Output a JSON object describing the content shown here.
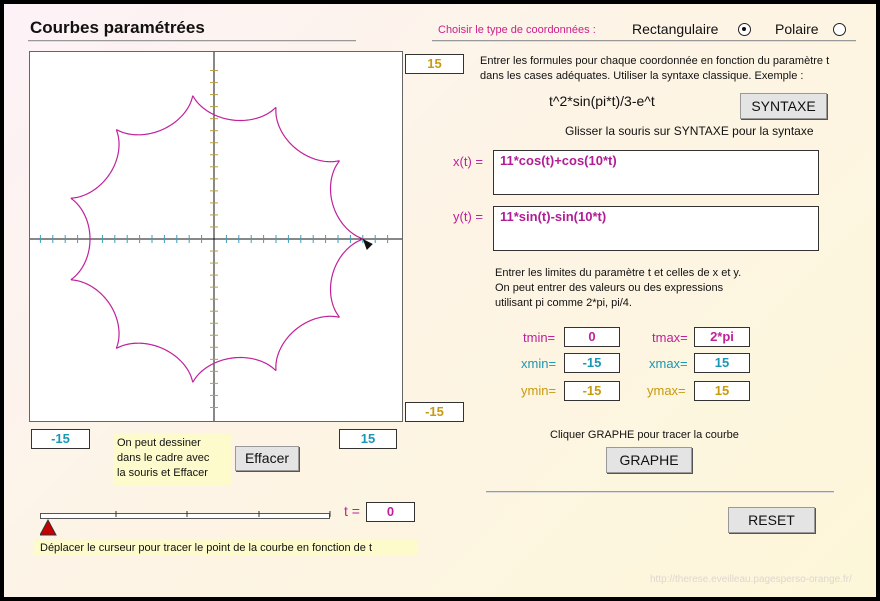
{
  "app": {
    "title": "Courbes paramétrées"
  },
  "coords": {
    "label": "Choisir le type de coordonnées :",
    "options": [
      {
        "label": "Rectangulaire",
        "selected": true
      },
      {
        "label": "Polaire",
        "selected": false
      }
    ]
  },
  "graph": {
    "y_top": "15",
    "y_bottom": "-15",
    "x_left": "-15",
    "x_right": "15"
  },
  "instructions": {
    "line1": "Entrer les formules pour chaque coordonnée en fonction du paramètre t",
    "line2": "dans les cases adéquates. Utiliser la syntaxe classique. Exemple :",
    "example": "t^2*sin(pi*t)/3-e^t",
    "syntax_button": "SYNTAXE",
    "syntax_hint": "Glisser la souris sur SYNTAXE pour la syntaxe"
  },
  "formulas": {
    "x_label": "x(t) =",
    "x_value": "11*cos(t)+cos(10*t)",
    "y_label": "y(t) =",
    "y_value": "11*sin(t)-sin(10*t)"
  },
  "limits_info": {
    "line1": "Entrer les limites  du paramètre t et celles de  x et  y.",
    "line2": "On peut entrer des valeurs ou des expressions",
    "line3": "utilisant pi comme  2*pi, pi/4."
  },
  "limits": {
    "tmin_label": "tmin=",
    "tmin": "0",
    "tmax_label": "tmax=",
    "tmax": "2*pi",
    "xmin_label": "xmin=",
    "xmin": "-15",
    "xmax_label": "xmax=",
    "xmax": "15",
    "ymin_label": "ymin=",
    "ymin": "-15",
    "ymax_label": "ymax=",
    "ymax": "15"
  },
  "graphe": {
    "hint": "Cliquer GRAPHE pour tracer la courbe",
    "button": "GRAPHE"
  },
  "draw": {
    "note_line1": "On   peut   dessiner",
    "note_line2": "dans le cadre avec",
    "note_line3": "la souris et  Effacer",
    "clear_button": "Effacer"
  },
  "slider": {
    "t_label": "t =",
    "t_value": "0",
    "value_fraction": 0,
    "hint": "Déplacer le curseur pour tracer le point de la courbe en fonction de t"
  },
  "reset_button": "RESET",
  "credit": "http://therese.eveilleau.pagesperso-orange.fr/",
  "colors": {
    "curve": "#c0219a",
    "axis_ticks": "#3aa0b8",
    "y_ticks": "#b8a040",
    "accent_pink": "#cc1f8a"
  }
}
